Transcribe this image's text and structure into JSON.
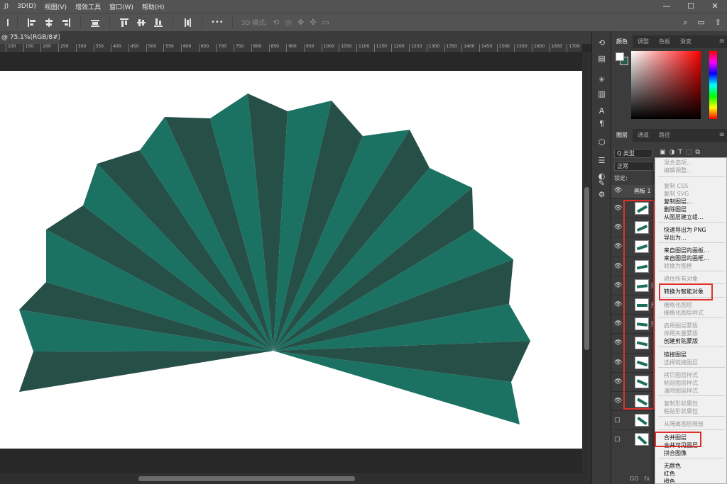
{
  "menubar": {
    "items": [
      "J)",
      "3D(D)",
      "视图(V)",
      "增效工具",
      "窗口(W)",
      "帮助(H)"
    ],
    "window_controls": [
      "—",
      "☐",
      "✕"
    ]
  },
  "optbar": {
    "mode_3d_label": "3D 模式:",
    "more_label": "•••"
  },
  "document": {
    "tab_title": "@ 75.1%(RGB/8#) *",
    "close": "×"
  },
  "ruler": {
    "ticks": [
      "100",
      "150",
      "200",
      "250",
      "300",
      "350",
      "400",
      "450",
      "500",
      "550",
      "600",
      "650",
      "700",
      "750",
      "800",
      "850",
      "900",
      "950",
      "1000",
      "1050",
      "1100",
      "1150",
      "1200",
      "1250",
      "1300",
      "1350",
      "1400",
      "1450",
      "1500",
      "1550",
      "1600",
      "1650",
      "1700"
    ]
  },
  "colors": {
    "fan_light": "#1b7262",
    "fan_dark": "#264f47",
    "highlight_red": "#e0302c",
    "bg_swatch": "#2a5a4e"
  },
  "color_panel": {
    "tabs": [
      "颜色",
      "调整",
      "色板",
      "渐变"
    ]
  },
  "layers_panel": {
    "tabs": [
      "图层",
      "通道",
      "路径"
    ],
    "filter_label": "Q 类型",
    "blend_mode": "正常",
    "lock_label": "锁定:",
    "artboard_label": "画板 1",
    "layer_fragments": [
      "形",
      "形状",
      "形"
    ],
    "bottom_icons": [
      "GO",
      "fx"
    ]
  },
  "context_menu": {
    "items": [
      {
        "label": "混合选项...",
        "enabled": false
      },
      {
        "label": "编辑调整...",
        "enabled": false
      },
      {
        "label": "复制 CSS",
        "enabled": false
      },
      {
        "label": "复制 SVG",
        "enabled": false
      },
      {
        "label": "复制图层...",
        "enabled": true
      },
      {
        "label": "删除图层",
        "enabled": true
      },
      {
        "label": "从图层建立组...",
        "enabled": true
      },
      {
        "label": "快速导出为 PNG",
        "enabled": true
      },
      {
        "label": "导出为...",
        "enabled": true
      },
      {
        "label": "来自图层的画板...",
        "enabled": true
      },
      {
        "label": "来自图层的画框...",
        "enabled": true
      },
      {
        "label": "转换为图框",
        "enabled": false
      },
      {
        "label": "遮住所有对象",
        "enabled": false
      },
      {
        "label": "转换为智能对象",
        "enabled": true
      },
      {
        "label": "栅格化图层",
        "enabled": false
      },
      {
        "label": "栅格化图层样式",
        "enabled": false
      },
      {
        "label": "启用图层蒙版",
        "enabled": false
      },
      {
        "label": "停用矢量蒙版",
        "enabled": false
      },
      {
        "label": "创建剪贴蒙版",
        "enabled": true
      },
      {
        "label": "链接图层",
        "enabled": true
      },
      {
        "label": "选择链接图层",
        "enabled": false
      },
      {
        "label": "拷贝图层样式",
        "enabled": false
      },
      {
        "label": "粘贴图层样式",
        "enabled": false
      },
      {
        "label": "清除图层样式",
        "enabled": false
      },
      {
        "label": "复制形状属性",
        "enabled": false
      },
      {
        "label": "粘贴形状属性",
        "enabled": false
      },
      {
        "label": "从隔离图层释放",
        "enabled": false
      },
      {
        "label": "合并图层",
        "enabled": true
      },
      {
        "label": "合并可见图层",
        "enabled": true
      },
      {
        "label": "拼合图像",
        "enabled": true
      },
      {
        "label": "无颜色",
        "enabled": true
      },
      {
        "label": "红色",
        "enabled": true
      },
      {
        "label": "橙色",
        "enabled": true
      }
    ]
  }
}
